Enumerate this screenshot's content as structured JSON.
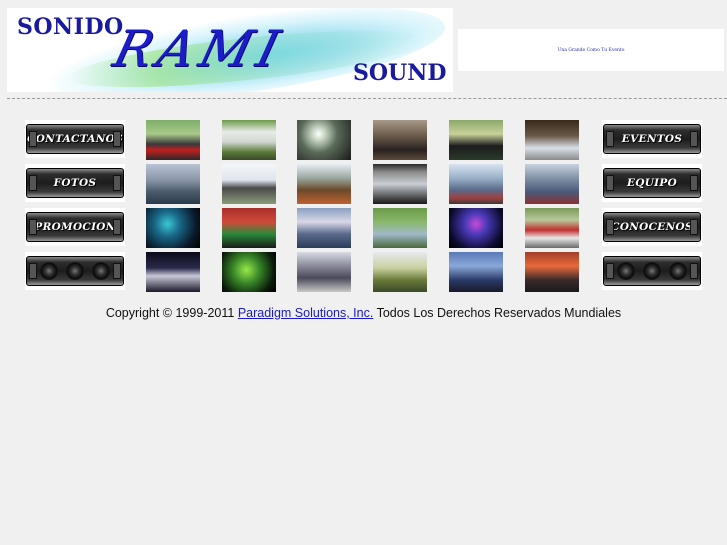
{
  "header": {
    "logo": {
      "word_top": "SONIDO",
      "word_main": "RAMI",
      "word_bottom": "SOUND"
    },
    "banner_text": "Una Grande Como Tu Evento"
  },
  "nav": {
    "left": [
      {
        "label": "CONTACTANOS"
      },
      {
        "label": "FOTOS"
      },
      {
        "label": "PROMOCION"
      },
      {
        "label": ""
      }
    ],
    "right": [
      {
        "label": "EVENTOS"
      },
      {
        "label": "EQUIPO"
      },
      {
        "label": "CONOCENOS"
      },
      {
        "label": ""
      }
    ]
  },
  "footer": {
    "prefix": "Copyright © 1999-2011",
    "link": "Paradigm Solutions, Inc.",
    "suffix": "Todos Los Derechos Reservados Mundiales"
  },
  "colors": {
    "background": "#f0f0f0",
    "logo_blue": "#1c1cc8",
    "link": "#1a1acc"
  }
}
